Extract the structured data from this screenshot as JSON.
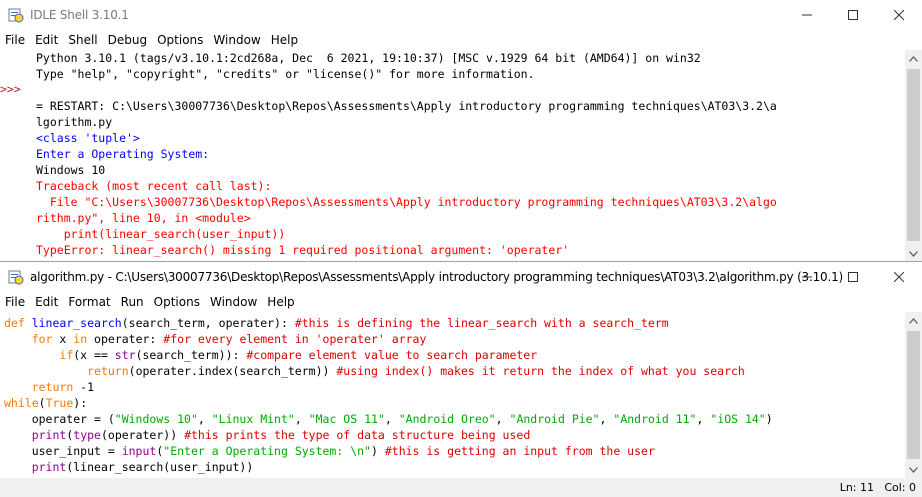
{
  "shell": {
    "title": "IDLE Shell 3.10.1",
    "menu": [
      "File",
      "Edit",
      "Shell",
      "Debug",
      "Options",
      "Window",
      "Help"
    ],
    "prompt": ">>>",
    "lines": [
      {
        "text": "Python 3.10.1 (tags/v3.10.1:2cd268a, Dec  6 2021, 19:10:37) [MSC v.1929 64 bit (AMD64)] on win32",
        "style": "c-blk"
      },
      {
        "text": "Type \"help\", \"copyright\", \"credits\" or \"license()\" for more information.",
        "style": "c-blk"
      },
      {
        "text": "",
        "style": "c-blk"
      },
      {
        "text": "= RESTART: C:\\Users\\30007736\\Desktop\\Repos\\Assessments\\Apply introductory programming techniques\\AT03\\3.2\\a",
        "style": "c-blk"
      },
      {
        "text": "lgorithm.py",
        "style": "c-blk"
      },
      {
        "text": "<class 'tuple'>",
        "style": "c-blue"
      },
      {
        "text": "Enter a Operating System:",
        "style": "c-blue"
      },
      {
        "text": "Windows 10",
        "style": "c-blk"
      },
      {
        "text": "Traceback (most recent call last):",
        "style": "c-red"
      },
      {
        "text": "  File \"C:\\Users\\30007736\\Desktop\\Repos\\Assessments\\Apply introductory programming techniques\\AT03\\3.2\\algo",
        "style": "c-red"
      },
      {
        "text": "rithm.py\", line 10, in <module>",
        "style": "c-red"
      },
      {
        "text": "    print(linear_search(user_input))",
        "style": "c-red"
      },
      {
        "text": "TypeError: linear_search() missing 1 required positional argument: 'operater'",
        "style": "c-red"
      }
    ]
  },
  "editor": {
    "title": "algorithm.py - C:\\Users\\30007736\\Desktop\\Repos\\Assessments\\Apply introductory programming techniques\\AT03\\3.2\\algorithm.py (3.10.1)",
    "menu": [
      "File",
      "Edit",
      "Format",
      "Run",
      "Options",
      "Window",
      "Help"
    ],
    "lines": [
      [
        [
          "def ",
          "c-def"
        ],
        [
          "linear_search",
          "c-fn"
        ],
        [
          "(search_term, operater): ",
          "c-blk"
        ],
        [
          "#this is defining the linear_search with a search_term",
          "c-cm"
        ]
      ],
      [
        [
          "    ",
          "c-blk"
        ],
        [
          "for ",
          "c-kw"
        ],
        [
          "x ",
          "c-blk"
        ],
        [
          "in ",
          "c-kw"
        ],
        [
          "operater: ",
          "c-blk"
        ],
        [
          "#for every element in 'operater' array",
          "c-cm"
        ]
      ],
      [
        [
          "        ",
          "c-blk"
        ],
        [
          "if",
          "c-kw"
        ],
        [
          "(x == ",
          "c-blk"
        ],
        [
          "str",
          "c-bi"
        ],
        [
          "(search_term)): ",
          "c-blk"
        ],
        [
          "#compare element value to search parameter",
          "c-cm"
        ]
      ],
      [
        [
          "            ",
          "c-blk"
        ],
        [
          "return",
          "c-kw"
        ],
        [
          "(operater.index(search_term)) ",
          "c-blk"
        ],
        [
          "#using index() makes it return the index of what you search",
          "c-cm"
        ]
      ],
      [
        [
          "    ",
          "c-blk"
        ],
        [
          "return ",
          "c-kw"
        ],
        [
          "-1",
          "c-blk"
        ]
      ],
      [
        [
          "while",
          "c-kw"
        ],
        [
          "(",
          "c-blk"
        ],
        [
          "True",
          "c-kw"
        ],
        [
          "):",
          "c-blk"
        ]
      ],
      [
        [
          "    operater = (",
          "c-blk"
        ],
        [
          "\"Windows 10\"",
          "c-str"
        ],
        [
          ", ",
          "c-blk"
        ],
        [
          "\"Linux Mint\"",
          "c-str"
        ],
        [
          ", ",
          "c-blk"
        ],
        [
          "\"Mac OS 11\"",
          "c-str"
        ],
        [
          ", ",
          "c-blk"
        ],
        [
          "\"Android Oreo\"",
          "c-str"
        ],
        [
          ", ",
          "c-blk"
        ],
        [
          "\"Android Pie\"",
          "c-str"
        ],
        [
          ", ",
          "c-blk"
        ],
        [
          "\"Android 11\"",
          "c-str"
        ],
        [
          ", ",
          "c-blk"
        ],
        [
          "\"iOS 14\"",
          "c-str"
        ],
        [
          ")",
          "c-blk"
        ]
      ],
      [
        [
          "    ",
          "c-blk"
        ],
        [
          "print",
          "c-bi"
        ],
        [
          "(",
          "c-blk"
        ],
        [
          "type",
          "c-bi"
        ],
        [
          "(operater)) ",
          "c-blk"
        ],
        [
          "#this prints the type of data structure being used",
          "c-cm"
        ]
      ],
      [
        [
          "    user_input = ",
          "c-blk"
        ],
        [
          "input",
          "c-bi"
        ],
        [
          "(",
          "c-blk"
        ],
        [
          "\"Enter a Operating System: \\n\"",
          "c-str"
        ],
        [
          ") ",
          "c-blk"
        ],
        [
          "#this is getting an input from the user",
          "c-cm"
        ]
      ],
      [
        [
          "    ",
          "c-blk"
        ],
        [
          "print",
          "c-bi"
        ],
        [
          "(linear_search(user_input))",
          "c-blk"
        ]
      ]
    ],
    "status": {
      "ln": "Ln: 11",
      "col": "Col: 0"
    }
  }
}
